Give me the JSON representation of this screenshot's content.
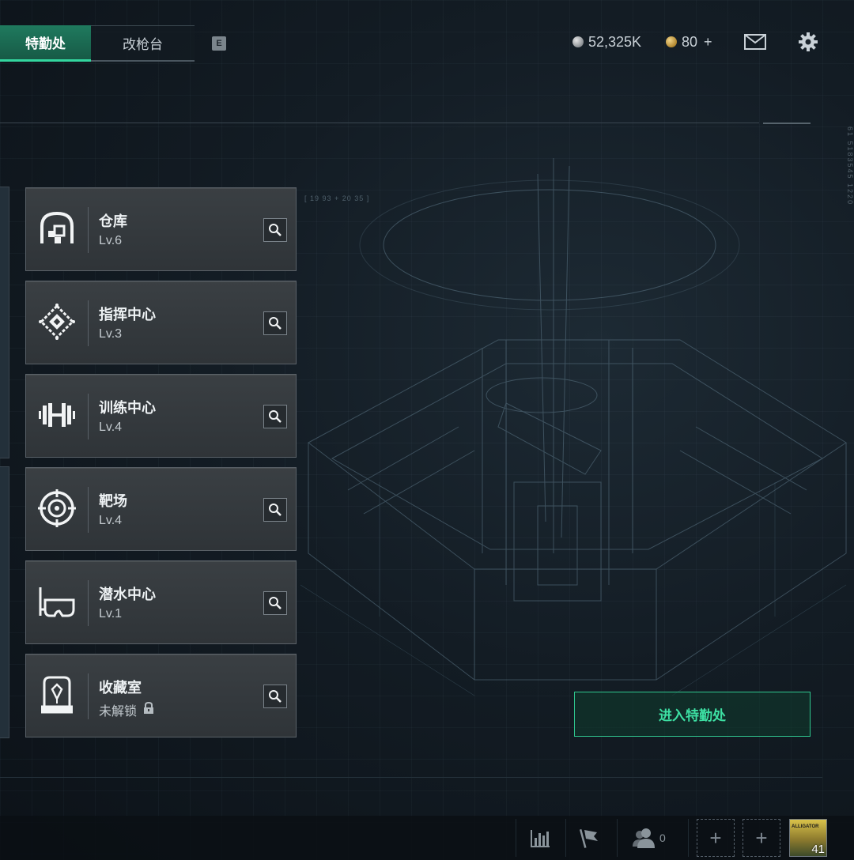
{
  "tabs": [
    {
      "label": "特勤处",
      "active": true
    },
    {
      "label": "改枪台",
      "active": false
    }
  ],
  "key_hint": "E",
  "currency": {
    "silver": "52,325K",
    "gold": "80",
    "gold_add": "+"
  },
  "top_icons": [
    "mail-icon",
    "settings-gear-icon"
  ],
  "side_numbers": "61 5183545 1220",
  "coords_label": "[ 19 93 + 20 35 ]",
  "facilities": [
    {
      "name": "仓库",
      "level": "Lv.6",
      "icon": "warehouse-icon",
      "locked": false
    },
    {
      "name": "指挥中心",
      "level": "Lv.3",
      "icon": "command-center-icon",
      "locked": false
    },
    {
      "name": "训练中心",
      "level": "Lv.4",
      "icon": "dumbbell-icon",
      "locked": false
    },
    {
      "name": "靶场",
      "level": "Lv.4",
      "icon": "target-icon",
      "locked": false
    },
    {
      "name": "潜水中心",
      "level": "Lv.1",
      "icon": "diving-mask-icon",
      "locked": false
    },
    {
      "name": "收藏室",
      "level": "未解锁",
      "icon": "collection-case-icon",
      "locked": true
    }
  ],
  "enter_button": "进入特勤处",
  "bottom_bar": {
    "friends_count": "0",
    "slot_add": "+",
    "player_level": "41",
    "avatar_text": "ALLIGATOR"
  },
  "colors": {
    "accent": "#33d69f",
    "tab_active_bg": "#1d6b54",
    "card_bg": "#35393d",
    "background": "#131c24"
  }
}
